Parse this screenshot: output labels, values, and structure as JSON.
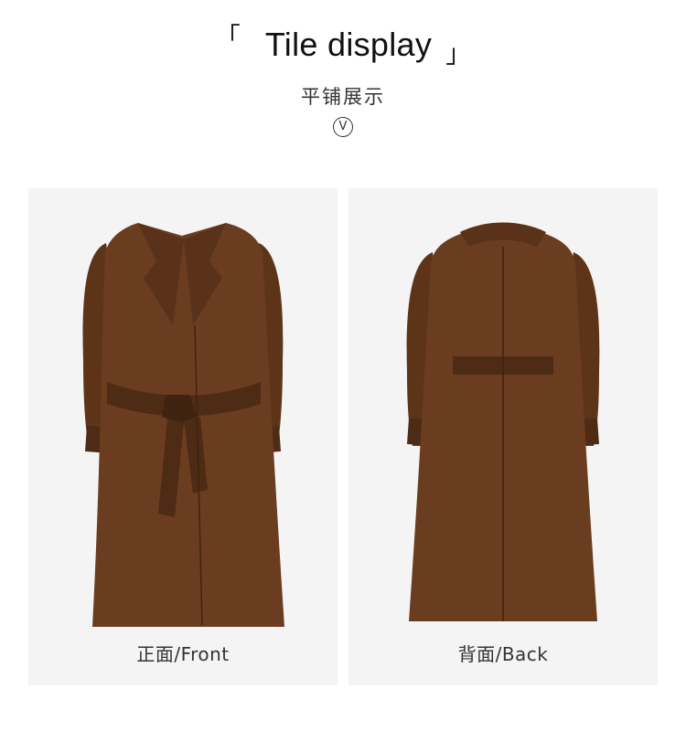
{
  "header": {
    "bracket_open": "「",
    "title": "Tile display",
    "bracket_close": "」",
    "subtitle": "平铺展示",
    "badge": "V"
  },
  "panels": [
    {
      "caption": "正面/Front"
    },
    {
      "caption": "背面/Back"
    }
  ],
  "colors": {
    "coat": "#6b3d20",
    "coat_shadow": "#4e2b15",
    "panel_bg": "#f4f4f4"
  }
}
